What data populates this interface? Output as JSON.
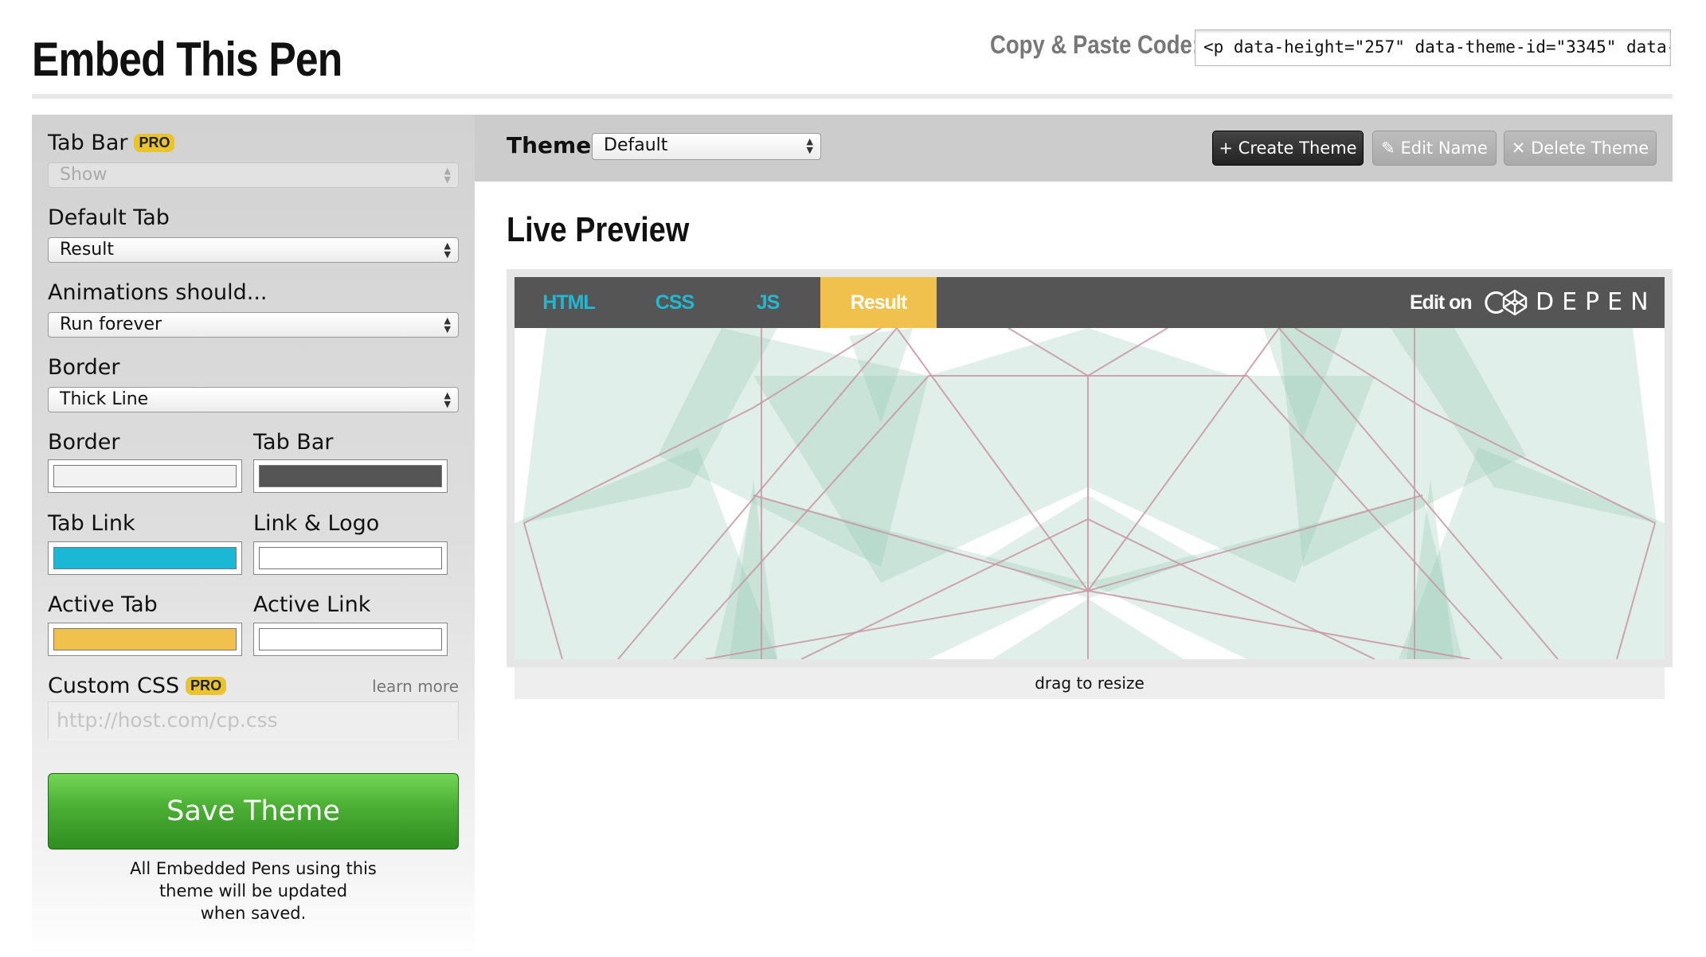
{
  "page": {
    "title": "Embed This Pen"
  },
  "copy_paste": {
    "label": "Copy & Paste Code:",
    "code": "<p data-height=\"257\" data-theme-id=\"3345\" data-"
  },
  "sidebar": {
    "tab_bar": {
      "label": "Tab Bar",
      "badge": "PRO",
      "value": "Show"
    },
    "default_tab": {
      "label": "Default Tab",
      "value": "Result"
    },
    "animations": {
      "label": "Animations should...",
      "value": "Run forever"
    },
    "border": {
      "label": "Border",
      "value": "Thick Line"
    },
    "colors": {
      "border": {
        "label": "Border",
        "color": "#f2f2f2"
      },
      "tab_bar": {
        "label": "Tab Bar",
        "color": "#555555"
      },
      "tab_link": {
        "label": "Tab Link",
        "color": "#1ab8d5"
      },
      "link_logo": {
        "label": "Link & Logo",
        "color": "#ffffff"
      },
      "active_tab": {
        "label": "Active Tab",
        "color": "#f0c24d"
      },
      "active_link": {
        "label": "Active Link",
        "color": "#ffffff"
      }
    },
    "custom_css": {
      "label": "Custom CSS",
      "badge": "PRO",
      "learn_more": "learn more",
      "placeholder": "http://host.com/cp.css"
    },
    "save_button": "Save Theme",
    "note_lines": [
      "All Embedded Pens using this",
      "theme will be updated",
      "when saved."
    ]
  },
  "theme_bar": {
    "label": "Theme:",
    "selected": "Default",
    "buttons": {
      "create": "+ Create Theme",
      "edit": "✎ Edit Name",
      "delete": "✕ Delete Theme"
    }
  },
  "preview": {
    "title": "Live Preview",
    "tabs": [
      "HTML",
      "CSS",
      "JS",
      "Result"
    ],
    "active_tab": "Result",
    "edit_on": "Edit on",
    "logo_text": "DEPEN",
    "resize_text": "drag to resize"
  }
}
